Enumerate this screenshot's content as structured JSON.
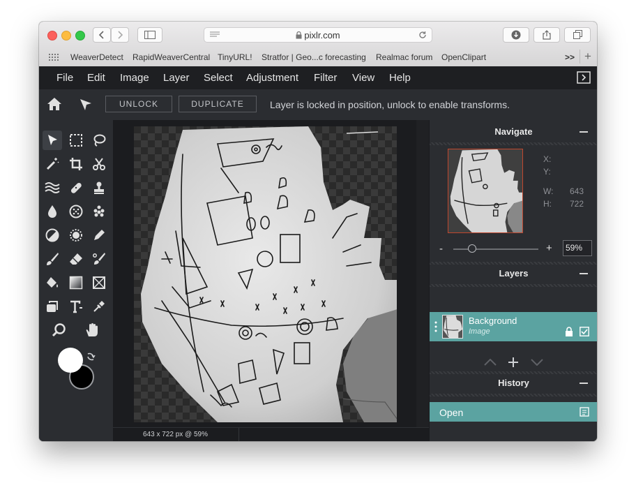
{
  "browser": {
    "url": "pixlr.com",
    "bookmarks": [
      "WeaverDetect",
      "RapidWeaverCentral",
      "TinyURL!",
      "Stratfor | Geo...c forecasting",
      "Realmac forum",
      "OpenClipart"
    ],
    "overflow": ">>",
    "new_tab": "+"
  },
  "menu": [
    "File",
    "Edit",
    "Image",
    "Layer",
    "Select",
    "Adjustment",
    "Filter",
    "View",
    "Help"
  ],
  "options": {
    "unlock_label": "UNLOCK",
    "duplicate_label": "DUPLICATE",
    "message": "Layer is locked in position, unlock to enable transforms."
  },
  "tools": [
    "move-tool",
    "marquee-tool",
    "lasso-tool",
    "wand-tool",
    "crop-tool",
    "cut-tool",
    "liquify-tool",
    "heal-tool",
    "clone-tool",
    "drop-tool",
    "sponge-tool",
    "spot-heal-tool",
    "dodge-tool",
    "burn-tool",
    "pencil-tool",
    "brush-tool",
    "eraser-tool",
    "replace-color-tool",
    "fill-tool",
    "gradient-tool",
    "shape-tool",
    "layer-tool",
    "text-tool",
    "picker-tool",
    "zoom-tool",
    "hand-tool"
  ],
  "colors": {
    "foreground": "#ffffff",
    "background": "#000000",
    "accent": "#5ba3a1"
  },
  "navigate": {
    "title": "Navigate",
    "x_label": "X:",
    "y_label": "Y:",
    "w_label": "W:",
    "w_value": "643",
    "h_label": "H:",
    "h_value": "722",
    "zoom_minus": "-",
    "zoom_plus": "+",
    "zoom_value": "59%",
    "zoom_slider_fraction": 0.22
  },
  "layers": {
    "title": "Layers",
    "items": [
      {
        "name": "Background",
        "type": "Image",
        "locked": true,
        "visible": true
      }
    ]
  },
  "history": {
    "title": "History",
    "items": [
      {
        "label": "Open"
      }
    ]
  },
  "status": "643 x 722 px @ 59%"
}
